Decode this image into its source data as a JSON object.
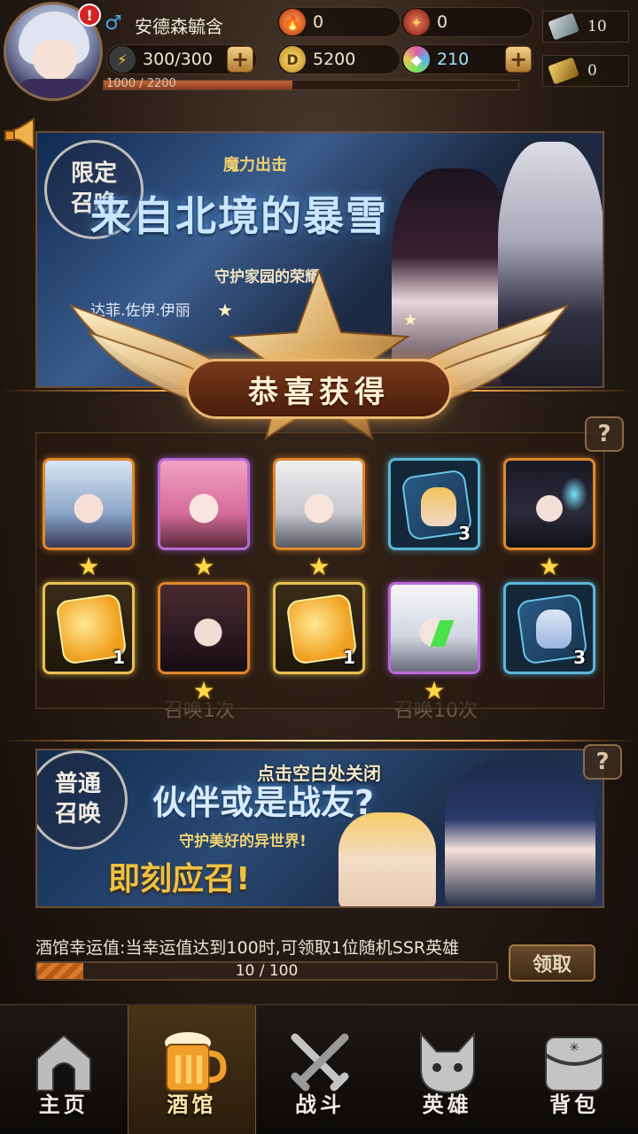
{
  "player": {
    "name": "安德森毓含",
    "gender_symbol": "♂",
    "alert": "!",
    "exp_text": "1000 / 2200",
    "exp_fraction": 0.4545
  },
  "resources": {
    "energy": "300/300",
    "fire": "0",
    "crystal": "0",
    "gold": "5200",
    "gems": "210",
    "ticket_silver": "10",
    "ticket_gold": "0"
  },
  "banners": {
    "limited": {
      "badge_top": "限定",
      "badge_bottom": "召唤",
      "tagline": "魔力出击",
      "title": "来自北境的暴雪",
      "subtitle": "守护家园的荣耀",
      "heroes_line": "达菲.佐伊.伊丽"
    },
    "normal": {
      "badge_top": "普通",
      "badge_bottom": "召唤",
      "title": "伙伴或是战友?",
      "subtitle": "守护美好的异世界!",
      "cta": "即刻应召!"
    }
  },
  "background": {
    "summon_1": "召唤1次",
    "summon_10": "召唤10次"
  },
  "reward": {
    "title": "恭喜获得",
    "close_hint": "点击空白处关闭",
    "row1": [
      {
        "frame": "orange",
        "type": "hero",
        "stars": 1,
        "qty": ""
      },
      {
        "frame": "purple",
        "type": "hero",
        "stars": 1,
        "qty": ""
      },
      {
        "frame": "orange",
        "type": "hero",
        "stars": 1,
        "qty": ""
      },
      {
        "frame": "blue",
        "type": "shard",
        "stars": 0,
        "qty": "3"
      },
      {
        "frame": "orange",
        "type": "hero",
        "stars": 1,
        "qty": ""
      }
    ],
    "row2": [
      {
        "frame": "gold",
        "type": "universal-shard",
        "stars": 0,
        "qty": "1"
      },
      {
        "frame": "orange",
        "type": "hero",
        "stars": 1,
        "qty": ""
      },
      {
        "frame": "gold",
        "type": "universal-shard",
        "stars": 0,
        "qty": "1"
      },
      {
        "frame": "purple",
        "type": "hero",
        "stars": 1,
        "qty": ""
      },
      {
        "frame": "blue",
        "type": "shard",
        "stars": 0,
        "qty": "3"
      }
    ]
  },
  "luck": {
    "label": "酒馆幸运值:当幸运值达到100时,可领取1位随机SSR英雄",
    "progress_text": "10 / 100",
    "progress_fraction": 0.1,
    "claim_label": "领取"
  },
  "help_symbol": "?",
  "nav": [
    {
      "label": "主页",
      "icon": "home-icon",
      "active": false
    },
    {
      "label": "酒馆",
      "icon": "beer-mug-icon",
      "active": true
    },
    {
      "label": "战斗",
      "icon": "crossed-swords-icon",
      "active": false
    },
    {
      "label": "英雄",
      "icon": "cat-hero-icon",
      "active": false
    },
    {
      "label": "背包",
      "icon": "backpack-icon",
      "active": false
    }
  ],
  "colors": {
    "frame_orange": "#e0882e",
    "frame_purple": "#b86ad8",
    "frame_blue": "#5ab6d8",
    "frame_gold": "#e6c050",
    "star": "#ffd84a"
  }
}
